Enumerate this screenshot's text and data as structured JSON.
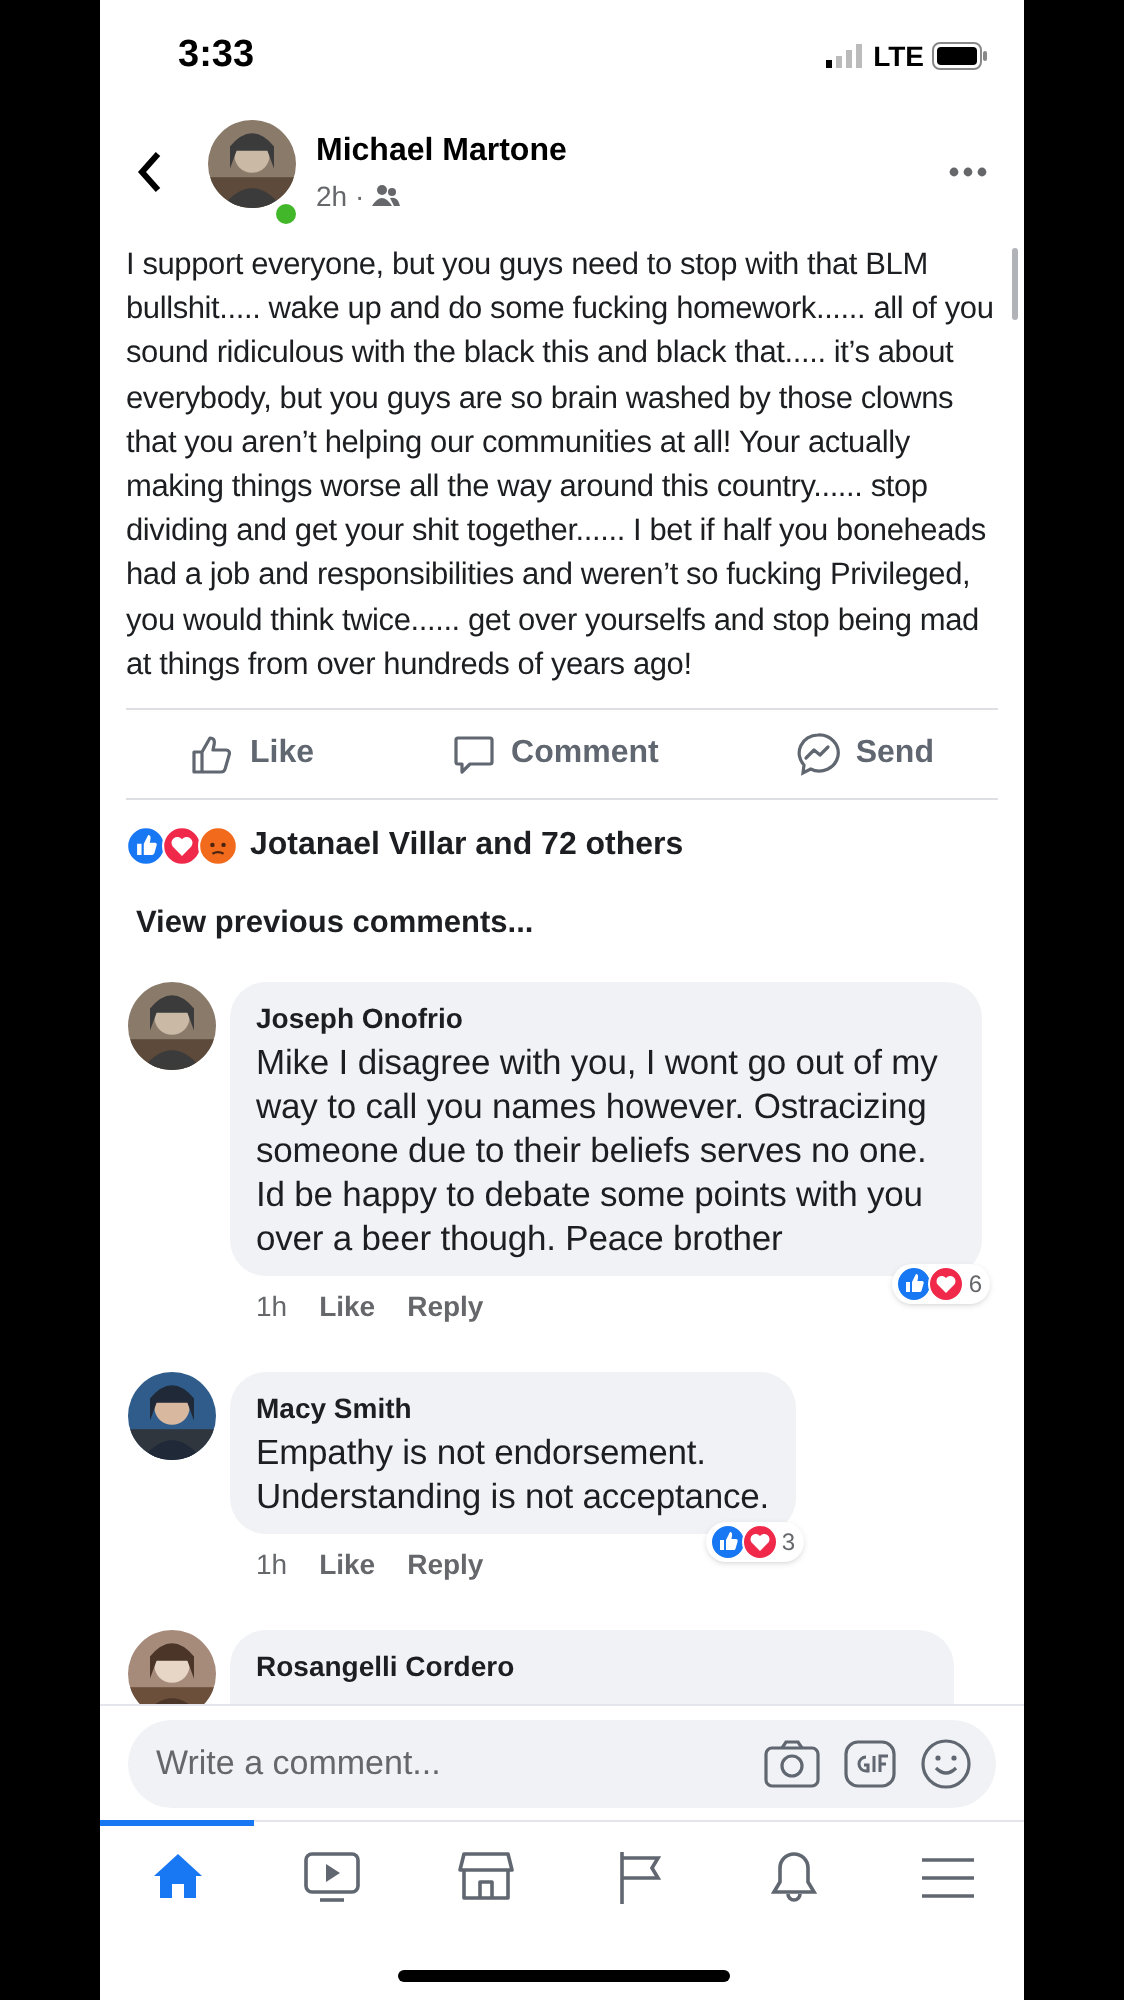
{
  "status_bar": {
    "time": "3:33",
    "network": "LTE"
  },
  "post": {
    "author": "Michael Martone",
    "online": true,
    "time": "2h ·",
    "text": "I support everyone, but you guys need to stop with that BLM bullshit..... wake up and do some fucking homework...... all of you sound ridiculous with the black this and black that..... it’s about everybody, but you guys are so brain washed by those clowns that you aren’t helping our communities at all! Your actually making things worse all the way around this country...... stop dividing and get your shit together...... I bet if half you boneheads had a job and responsibilities and weren’t so fucking Privileged, you would think twice...... get over yourselfs and stop being mad at things from over hundreds of years ago!"
  },
  "actions": [
    {
      "kind": "like",
      "label": "Like"
    },
    {
      "kind": "comment",
      "label": "Comment"
    },
    {
      "kind": "send",
      "label": "Send"
    }
  ],
  "reactions": {
    "kinds": [
      {
        "kind": "like"
      },
      {
        "kind": "love"
      },
      {
        "kind": "angry"
      }
    ],
    "summary": "Jotanael Villar and 72 others"
  },
  "view_previous": "View previous comments...",
  "comments": [
    {
      "author": "Joseph Onofrio",
      "text": "Mike I disagree with you, I wont go out of my way to call you names however. Ostracizing someone due to their beliefs serves no one. Id be happy to debate some points with you over a beer though. Peace brother",
      "time": "1h",
      "like": "Like",
      "reply": "Reply",
      "reactions": [
        {
          "kind": "like"
        },
        {
          "kind": "love"
        }
      ],
      "count": "6"
    },
    {
      "author": "Macy Smith",
      "text": "Empathy is not endorsement.\nUnderstanding is not acceptance.",
      "time": "1h",
      "like": "Like",
      "reply": "Reply",
      "reactions": [
        {
          "kind": "like"
        },
        {
          "kind": "love"
        }
      ],
      "count": "3"
    },
    {
      "author": "Rosangelli Cordero"
    }
  ],
  "composer": {
    "placeholder": "Write a comment..."
  },
  "tabs": [
    {
      "kind": "home",
      "selected": true
    },
    {
      "kind": "watch",
      "selected": false
    },
    {
      "kind": "marketplace",
      "selected": false
    },
    {
      "kind": "pages",
      "selected": false
    },
    {
      "kind": "notifications",
      "selected": false
    },
    {
      "kind": "menu",
      "selected": false
    }
  ]
}
